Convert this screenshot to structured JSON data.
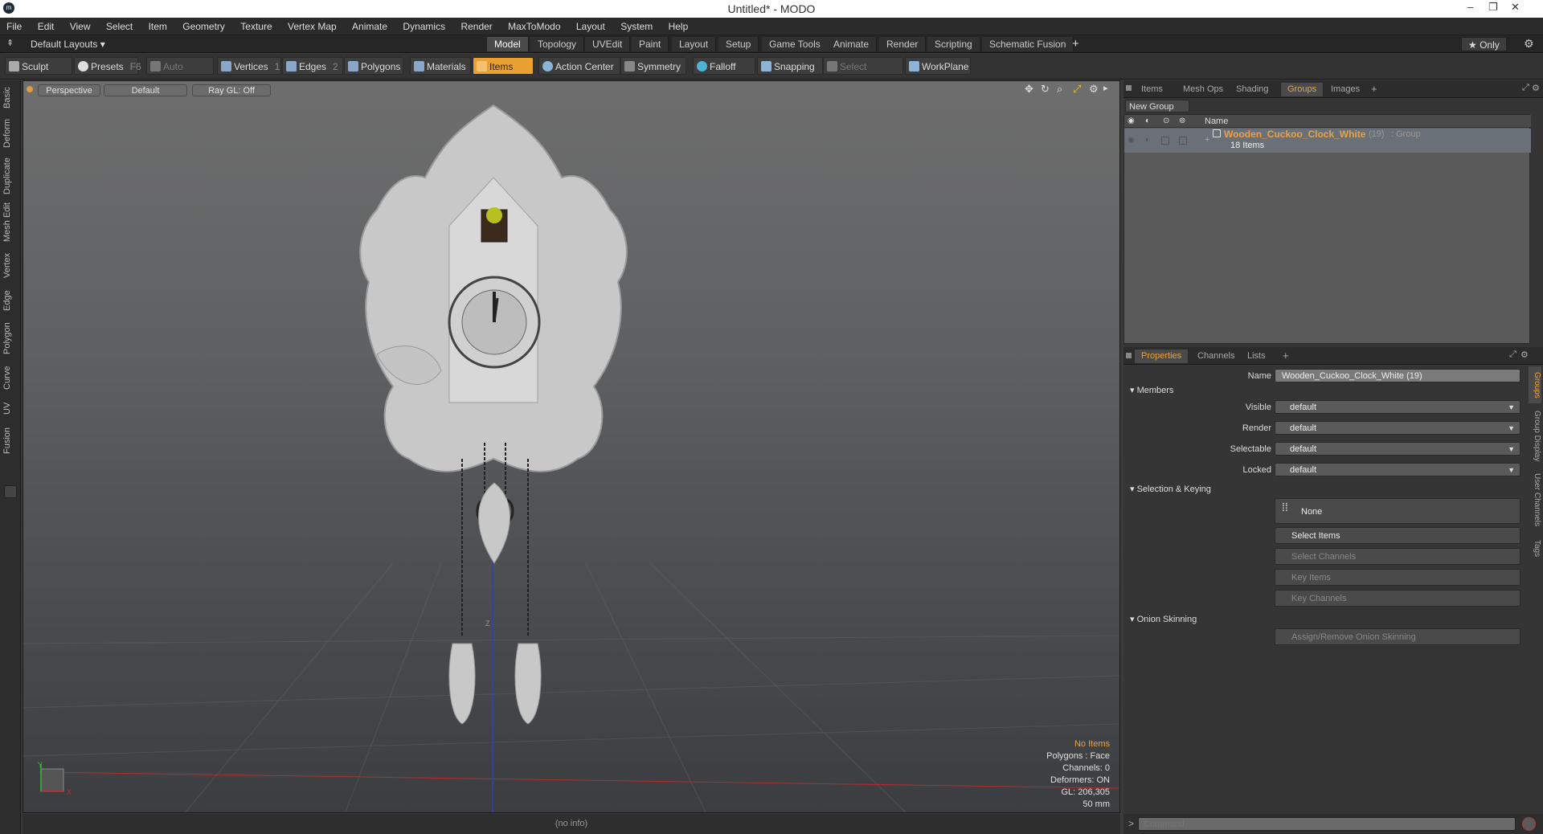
{
  "window": {
    "title": "Untitled* - MODO",
    "logo": "m",
    "controls": [
      "–",
      "❐",
      "✕"
    ]
  },
  "menu": [
    "File",
    "Edit",
    "View",
    "Select",
    "Item",
    "Geometry",
    "Texture",
    "Vertex Map",
    "Animate",
    "Dynamics",
    "Render",
    "MaxToModo",
    "Layout",
    "System",
    "Help"
  ],
  "layoutbar": {
    "layouts_label": "Default Layouts ▾",
    "tabs": [
      "Model",
      "Topology",
      "UVEdit",
      "Paint",
      "Layout",
      "Setup",
      "Game Tools",
      "Animate",
      "Render",
      "Scripting",
      "Schematic Fusion"
    ],
    "active_tab": "Model",
    "add": "+",
    "only_label": "★  Only"
  },
  "toolbar": {
    "sculpt": "Sculpt",
    "presets": "Presets",
    "presets_key": "F6",
    "auto_select": "Auto Select",
    "vertices": "Vertices",
    "vertices_key": "1",
    "edges": "Edges",
    "edges_key": "2",
    "polygons": "Polygons",
    "materials": "Materials",
    "items": "Items",
    "action_center": "Action Center",
    "symmetry": "Symmetry",
    "falloff": "Falloff",
    "snapping": "Snapping",
    "select_through": "Select Through",
    "workplane": "WorkPlane"
  },
  "left_tabs": [
    "Basic",
    "Deform",
    "Duplicate",
    "Mesh Edit",
    "Vertex",
    "Edge",
    "Polygon",
    "Curve",
    "UV",
    "Fusion"
  ],
  "viewport": {
    "buttons": [
      "Perspective",
      "Default",
      "Ray GL: Off"
    ],
    "info": {
      "items": "No Items",
      "polygons": "Polygons : Face",
      "channels": "Channels: 0",
      "deformers": "Deformers: ON",
      "gl": "GL: 206,305",
      "lens": "50 mm"
    },
    "axis_y": "Y",
    "axis_x": "X",
    "axis_z": "Z"
  },
  "status_text": "(no info)",
  "groups_panel": {
    "tabs": [
      "Items",
      "Mesh Ops",
      "Shading",
      "Groups",
      "Images"
    ],
    "active_tab": "Groups",
    "add": "+",
    "new_group": "New Group",
    "column_name": "Name",
    "group_name": "Wooden_Cuckoo_Clock_White",
    "group_count": "(19)",
    "group_type": ": Group",
    "group_items": "18 Items"
  },
  "properties_panel": {
    "tabs": [
      "Properties",
      "Channels",
      "Lists"
    ],
    "active_tab": "Properties",
    "add": "+",
    "name_label": "Name",
    "name_value": "Wooden_Cuckoo_Clock_White (19)",
    "members_section": "Members",
    "fields": [
      {
        "label": "Visible",
        "value": "default"
      },
      {
        "label": "Render",
        "value": "default"
      },
      {
        "label": "Selectable",
        "value": "default"
      },
      {
        "label": "Locked",
        "value": "default"
      }
    ],
    "selection_section": "Selection & Keying",
    "none_label": "None",
    "select_items": "Select Items",
    "select_channels": "Select Channels",
    "key_items": "Key Items",
    "key_channels": "Key Channels",
    "onion_section": "Onion Skinning",
    "assign_onion": "Assign/Remove Onion Skinning",
    "side_tabs": [
      "Groups",
      "Group Display",
      "User Channels",
      "Tags"
    ]
  },
  "command": {
    "placeholder": "Command",
    "prompt": ">"
  },
  "colors": {
    "accent": "#f0a040",
    "active_tool": "#e8a030",
    "panel": "#353535",
    "viewport_top": "#6e6e6e"
  }
}
